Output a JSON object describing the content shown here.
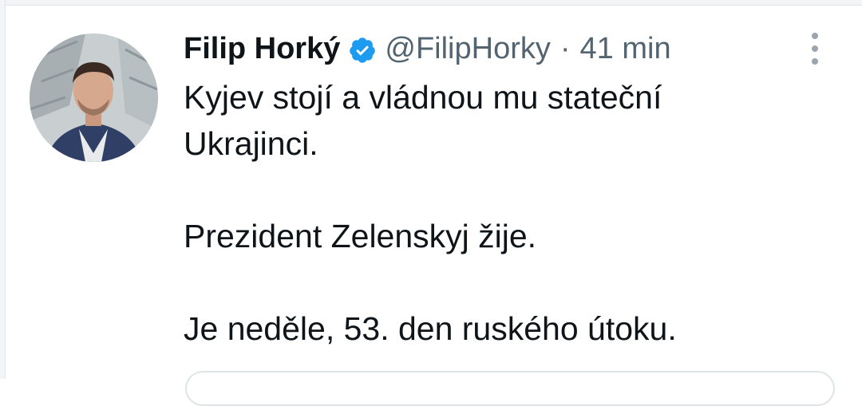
{
  "tweet": {
    "author_name": "Filip Horký",
    "handle": "@FilipHorky",
    "separator": "·",
    "time": "41 min",
    "lines": [
      "Kyjev stojí a vládnou mu stateční",
      "Ukrajinci.",
      "",
      "Prezident Zelenskyj žije.",
      "",
      "Je neděle, 53. den ruského útoku."
    ],
    "icons": {
      "verified": "verified-badge-icon",
      "more": "more-vertical-icon",
      "avatar": "avatar"
    },
    "colors": {
      "verified": "#1d9bf0",
      "secondary_text": "#536471",
      "primary_text": "#0f1419"
    }
  }
}
